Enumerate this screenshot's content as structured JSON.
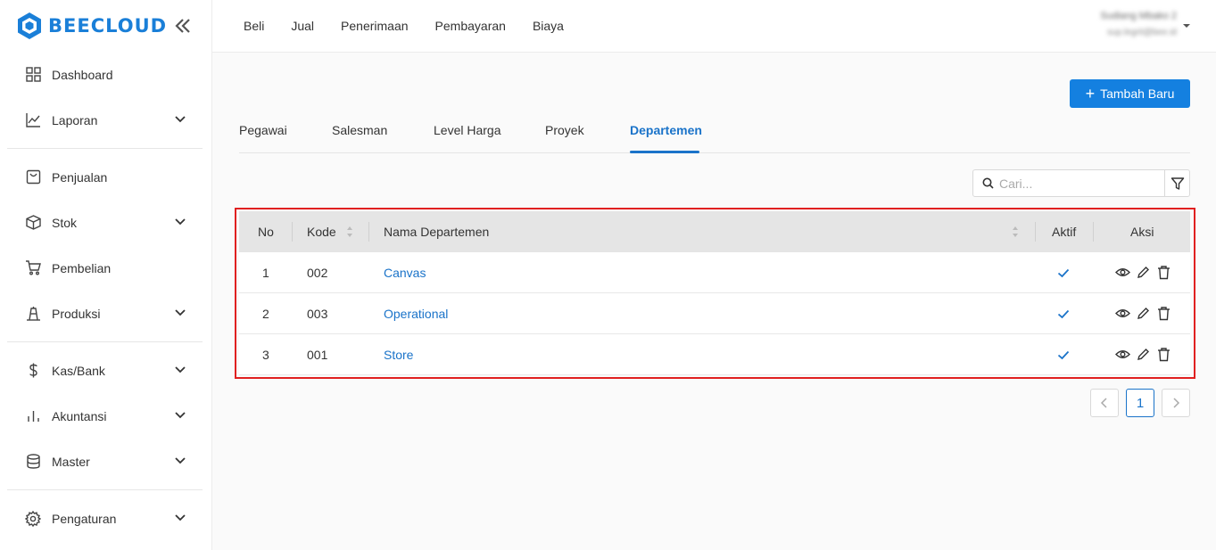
{
  "brand": {
    "name": "BEECLOUD",
    "color": "#1a7fd8"
  },
  "sidebar": {
    "items": [
      {
        "label": "Dashboard",
        "icon": "dashboard-grid-icon",
        "expandable": false
      },
      {
        "label": "Laporan",
        "icon": "chart-line-icon",
        "expandable": true
      },
      {
        "label": "Penjualan",
        "icon": "shopping-bag-icon",
        "expandable": false
      },
      {
        "label": "Stok",
        "icon": "cube-icon",
        "expandable": true
      },
      {
        "label": "Pembelian",
        "icon": "cart-icon",
        "expandable": false
      },
      {
        "label": "Produksi",
        "icon": "factory-icon",
        "expandable": true
      },
      {
        "label": "Kas/Bank",
        "icon": "dollar-icon",
        "expandable": true
      },
      {
        "label": "Akuntansi",
        "icon": "bar-chart-icon",
        "expandable": true
      },
      {
        "label": "Master",
        "icon": "database-icon",
        "expandable": true
      },
      {
        "label": "Pengaturan",
        "icon": "gear-icon",
        "expandable": true
      }
    ]
  },
  "topnav": {
    "items": [
      "Beli",
      "Jual",
      "Penerimaan",
      "Pembayaran",
      "Biaya"
    ]
  },
  "user": {
    "name": "Sudiang Mbako 2",
    "email": "sup.legrit@bee.id"
  },
  "actions": {
    "add_label": "Tambah Baru"
  },
  "tabs": {
    "items": [
      "Pegawai",
      "Salesman",
      "Level Harga",
      "Proyek",
      "Departemen"
    ],
    "active": "Departemen"
  },
  "search": {
    "placeholder": "Cari..."
  },
  "table": {
    "headers": {
      "no": "No",
      "kode": "Kode",
      "nama": "Nama Departemen",
      "aktif": "Aktif",
      "aksi": "Aksi"
    },
    "rows": [
      {
        "no": "1",
        "kode": "002",
        "nama": "Canvas",
        "aktif": true
      },
      {
        "no": "2",
        "kode": "003",
        "nama": "Operational",
        "aktif": true
      },
      {
        "no": "3",
        "kode": "001",
        "nama": "Store",
        "aktif": true
      }
    ]
  },
  "pagination": {
    "current": "1"
  },
  "colors": {
    "accent": "#1480e0",
    "link": "#1a73c9",
    "highlight": "#e02020"
  }
}
